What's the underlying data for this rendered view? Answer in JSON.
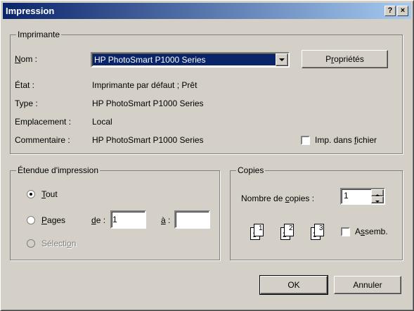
{
  "window": {
    "title": "Impression",
    "help_btn": "?",
    "close_btn": "×"
  },
  "printer": {
    "group_label": "Imprimante",
    "name_label_u": "N",
    "name_label_rest": "om :",
    "name_value": "HP PhotoSmart P1000 Series",
    "properties_btn_pre": "P",
    "properties_btn_u": "r",
    "properties_btn_post": "opriétés",
    "state_label": "État :",
    "state_value": "Imprimante par défaut ; Prêt",
    "type_label": "Type :",
    "type_value": "HP PhotoSmart P1000 Series",
    "location_label": "Emplacement :",
    "location_value": "Local",
    "comment_label": "Commentaire :",
    "comment_value": "HP PhotoSmart P1000 Series",
    "print_to_file_pre": "Imp. dans ",
    "print_to_file_u": "f",
    "print_to_file_post": "ichier"
  },
  "range": {
    "group_label": "Étendue d'impression",
    "all_u": "T",
    "all_rest": "out",
    "pages_u": "P",
    "pages_rest": "ages",
    "from_u": "d",
    "from_rest": "e :",
    "from_value": "1",
    "to_u": "à",
    "to_rest": " :",
    "to_value": "",
    "selection_pre": "Sélecti",
    "selection_u": "o",
    "selection_post": "n"
  },
  "copies": {
    "group_label": "Copies",
    "count_label_pre": "Nombre de ",
    "count_label_u": "c",
    "count_label_post": "opies :",
    "count_value": "1",
    "collate_pre": "A",
    "collate_u": "s",
    "collate_post": "semb.",
    "page_labels": [
      "1",
      "1",
      "2",
      "2",
      "3",
      "3"
    ]
  },
  "footer": {
    "ok": "OK",
    "cancel": "Annuler"
  }
}
